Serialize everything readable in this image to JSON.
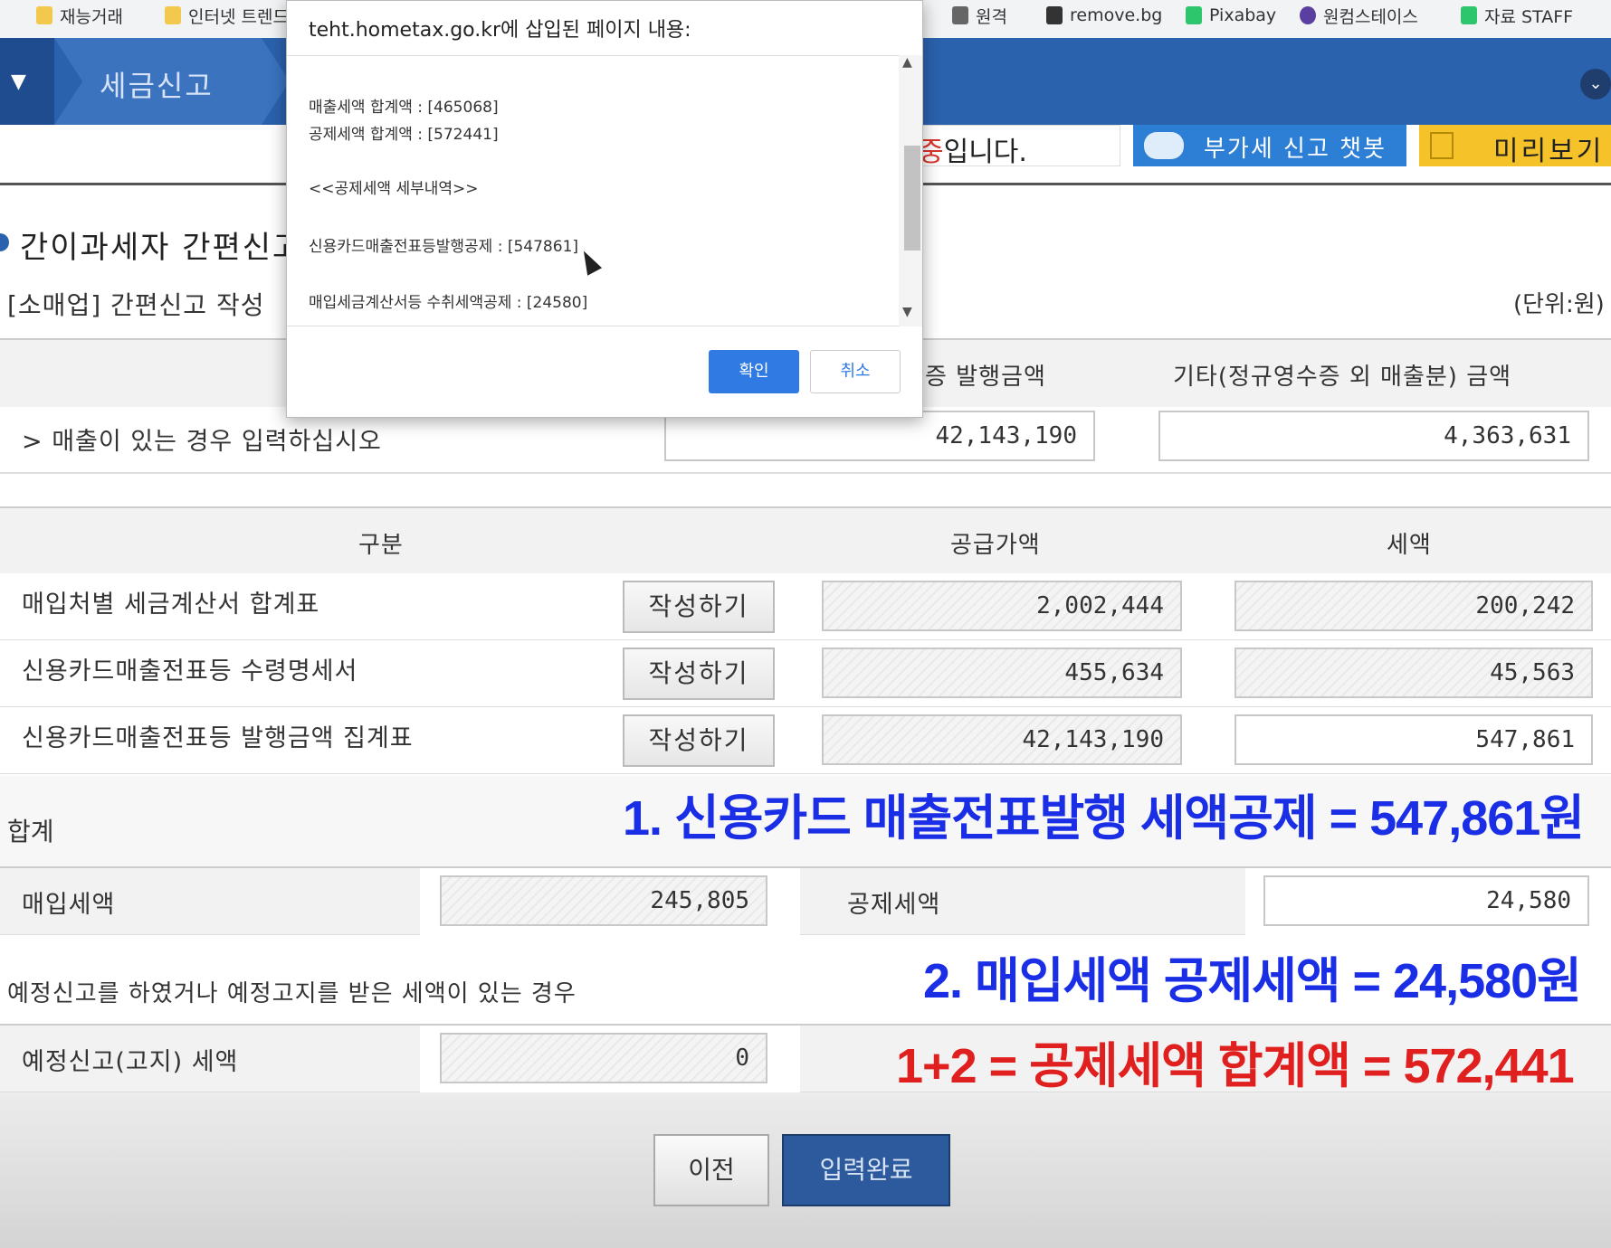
{
  "bookmarks": [
    {
      "label": "재능거래",
      "color": "#f2c94c"
    },
    {
      "label": "인터넷 트렌드",
      "color": "#f2c94c"
    },
    {
      "label": "원격",
      "color": "#666666"
    },
    {
      "label": "remove.bg",
      "color": "#333333"
    },
    {
      "label": "Pixabay",
      "color": "#2ec66d"
    },
    {
      "label": "원컴스테이스",
      "color": "#5b3fa0"
    },
    {
      "label": "자료 STAFF",
      "color": "#2ec66d"
    }
  ],
  "header": {
    "breadcrumb": "세금신고",
    "menu_icon": "dropdown-arrow",
    "collapse_icon": "chevron-down-icon"
  },
  "actions": {
    "notice_prefix": "중",
    "notice_suffix": "입니다.",
    "chatbot_label": "부가세 신고 챗봇",
    "preview_label": "미리보기"
  },
  "page": {
    "title": "간이과세자 간편신고",
    "subtitle": "[소매업] 간편신고 작성",
    "unit": "(단위:원)"
  },
  "sales": {
    "col_card": "증 발행금액",
    "col_other": "기타(정규영수증 외 매출분) 금액",
    "row_label": "> 매출이 있는 경우 입력하십시오",
    "card_amount": "42,143,190",
    "other_amount": "4,363,631"
  },
  "table": {
    "headers": [
      "구분",
      "공급가액",
      "세액"
    ],
    "write_label": "작성하기",
    "rows": [
      {
        "label": "매입처별 세금계산서 합계표",
        "supply": "2,002,444",
        "tax": "200,242"
      },
      {
        "label": "신용카드매출전표등 수령명세서",
        "supply": "455,634",
        "tax": "45,563"
      },
      {
        "label": "신용카드매출전표등 발행금액 집계표",
        "supply": "42,143,190",
        "tax": "547,861"
      }
    ]
  },
  "sum": {
    "label": "합계",
    "purchase_tax_label": "매입세액",
    "purchase_tax": "245,805",
    "deduction_label": "공제세액",
    "deduction": "24,580",
    "prelim_note": "예정신고를 하였거나 예정고지를 받은 세액이 있는 경우",
    "prelim_label": "예정신고(고지) 세액",
    "prelim_value": "0"
  },
  "annotations": {
    "line1": "1. 신용카드 매출전표발행 세액공제 = 547,861원",
    "line2": "2. 매입세액 공제세액 = 24,580원",
    "line3": "1+2 = 공제세액 합계액 = 572,441",
    "color_blue": "#1a2ee6",
    "color_red": "#e0201f"
  },
  "buttons": {
    "prev": "이전",
    "done": "입력완료"
  },
  "dialog": {
    "title": "teht.hometax.go.kr에 삽입된 페이지 내용:",
    "lines": [
      "매출세액 합계액 : [465068]",
      "공제세액 합계액 : [572441]",
      "<<공제세액 세부내역>>",
      "신용카드매출전표등발행공제 : [547861]",
      "매입세금계산서등 수취세액공제 : [24580]"
    ],
    "ok": "확인",
    "cancel": "취소"
  }
}
